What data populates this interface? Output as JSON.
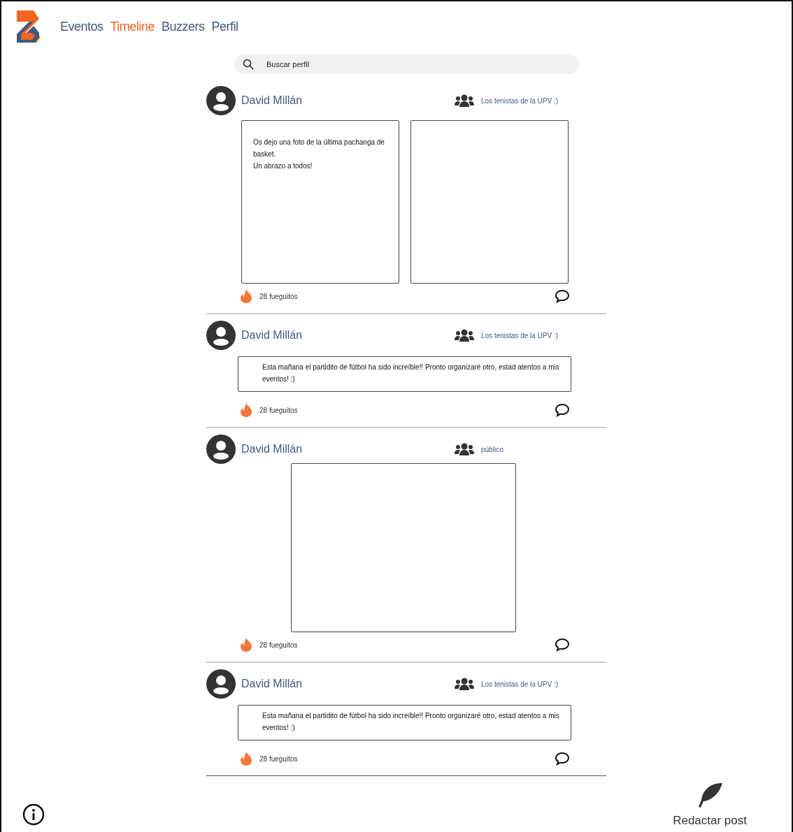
{
  "nav": {
    "items": [
      {
        "label": "Eventos",
        "selected": false
      },
      {
        "label": "Timeline",
        "selected": true
      },
      {
        "label": "Buzzers",
        "selected": false
      },
      {
        "label": "Perfil",
        "selected": false
      }
    ]
  },
  "search": {
    "placeholder": "Buscar perfil"
  },
  "posts": [
    {
      "kind": "text_image",
      "author": "David Millán",
      "audience": "Los tenistas de la UPV :)",
      "text": [
        "Os dejo una foto de la última pachanga de basket.",
        "Un abrazo a todos!"
      ],
      "reactions": "28 fueguitos"
    },
    {
      "kind": "text",
      "author": "David Millán",
      "audience": "Los tenistas de la UPV :)",
      "text": [
        "Esta mañana el partidito de fútbol ha sido increíble!! Pronto organizaré otro, estad atentos a mis eventos! :)"
      ],
      "reactions": "28 fueguitos"
    },
    {
      "kind": "image",
      "author": "David Millán",
      "audience": "público",
      "reactions": "28 fueguitos"
    },
    {
      "kind": "text",
      "author": "David Millán",
      "audience": "Los tenistas de la UPV :)",
      "text": [
        "Esta mañana el partidito de fútbol ha sido increíble!! Pronto organizaré otro, estad atentos a mis eventos! :)"
      ],
      "reactions": "28 fueguitos"
    }
  ],
  "compose": {
    "label": "Redactar post"
  }
}
